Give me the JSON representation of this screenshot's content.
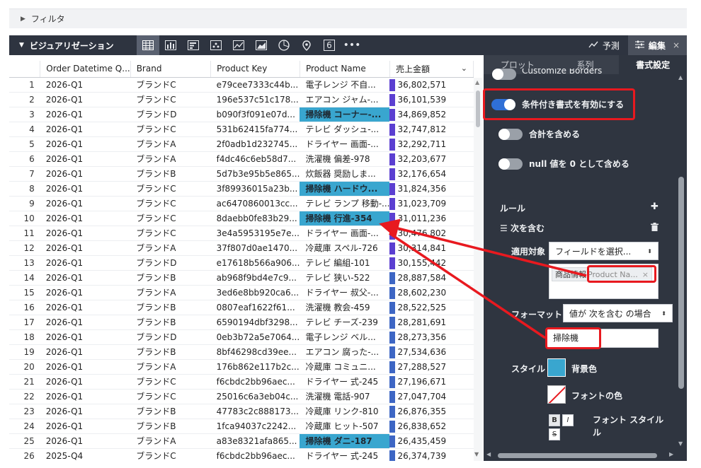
{
  "filter": {
    "label": "フィルタ"
  },
  "viz": {
    "title": "ビジュアリゼーション",
    "icons": [
      "table-icon",
      "bar-chart-icon",
      "horizontal-bar-icon",
      "scatter-icon",
      "line-chart-icon",
      "area-chart-icon",
      "pie-chart-icon",
      "map-pin-icon",
      "single-value-icon",
      "more-icon"
    ],
    "single_value_label": "6",
    "more_label": "•••",
    "forecast_label": "予測",
    "edit_label": "編集",
    "close_label": "×"
  },
  "table": {
    "columns": [
      "Order Datetime Q...",
      "Brand",
      "Product Key",
      "Product Name",
      "売上金額"
    ],
    "bar_colors": {
      "high": "#5b3fd1",
      "low": "#3d66c4"
    },
    "rows": [
      {
        "n": "1",
        "q": "2026-Q1",
        "brand": "ブランドC",
        "key": "e79cee7333c44b...",
        "name": "電子レンジ 不自...",
        "sales": "36,802,571",
        "hl": false,
        "bar": "high"
      },
      {
        "n": "2",
        "q": "2026-Q1",
        "brand": "ブランドC",
        "key": "196e537c51c178...",
        "name": "エアコン ジャム-...",
        "sales": "36,101,539",
        "hl": false,
        "bar": "high"
      },
      {
        "n": "3",
        "q": "2026-Q1",
        "brand": "ブランドD",
        "key": "b090f3f091e07d...",
        "name": "掃除機 コーナー-...",
        "sales": "34,869,852",
        "hl": true,
        "bar": "high"
      },
      {
        "n": "4",
        "q": "2026-Q1",
        "brand": "ブランドC",
        "key": "531b62415fa774...",
        "name": "テレビ ダッシュ-...",
        "sales": "32,747,812",
        "hl": false,
        "bar": "high"
      },
      {
        "n": "5",
        "q": "2026-Q1",
        "brand": "ブランドA",
        "key": "2f0adb1d232745...",
        "name": "ドライヤー 画面-...",
        "sales": "32,292,711",
        "hl": false,
        "bar": "high"
      },
      {
        "n": "6",
        "q": "2026-Q1",
        "brand": "ブランドA",
        "key": "f4dc46c6eb58d7...",
        "name": "洗濯機 偏差-978",
        "sales": "32,203,677",
        "hl": false,
        "bar": "high"
      },
      {
        "n": "7",
        "q": "2026-Q1",
        "brand": "ブランドB",
        "key": "5d7b3e95b5e865...",
        "name": "炊飯器 奨励しま...",
        "sales": "32,176,654",
        "hl": false,
        "bar": "high"
      },
      {
        "n": "8",
        "q": "2026-Q1",
        "brand": "ブランドC",
        "key": "3f89936015a23b...",
        "name": "掃除機 ハードウ...",
        "sales": "31,824,356",
        "hl": true,
        "bar": "high"
      },
      {
        "n": "9",
        "q": "2026-Q1",
        "brand": "ブランドC",
        "key": "ac6470860013cc...",
        "name": "テレビ ランプ 移動-...",
        "sales": "31,023,709",
        "hl": false,
        "bar": "high"
      },
      {
        "n": "10",
        "q": "2026-Q1",
        "brand": "ブランドC",
        "key": "8daebb0fe83b29...",
        "name": "掃除機 行進-354",
        "sales": "31,011,236",
        "hl": true,
        "bar": "high"
      },
      {
        "n": "11",
        "q": "2026-Q1",
        "brand": "ブランドC",
        "key": "3e4a5953195e7e...",
        "name": "ドライヤー 画面-...",
        "sales": "30,476,802",
        "hl": false,
        "bar": "high"
      },
      {
        "n": "12",
        "q": "2026-Q1",
        "brand": "ブランドA",
        "key": "37f807d0ae1470...",
        "name": "冷蔵庫 スペル-726",
        "sales": "30,314,841",
        "hl": false,
        "bar": "high"
      },
      {
        "n": "13",
        "q": "2026-Q1",
        "brand": "ブランドD",
        "key": "e17618b566a906...",
        "name": "テレビ 編組-101",
        "sales": "30,155,442",
        "hl": false,
        "bar": "high"
      },
      {
        "n": "14",
        "q": "2026-Q1",
        "brand": "ブランドB",
        "key": "ab968f9bd4e7c9...",
        "name": "テレビ 狭い-522",
        "sales": "28,887,584",
        "hl": false,
        "bar": "low"
      },
      {
        "n": "15",
        "q": "2026-Q1",
        "brand": "ブランドA",
        "key": "3ed6e8bb920ca6...",
        "name": "ドライヤー 叔父-...",
        "sales": "28,602,230",
        "hl": false,
        "bar": "low"
      },
      {
        "n": "16",
        "q": "2026-Q1",
        "brand": "ブランドB",
        "key": "0807eaf1622f61...",
        "name": "洗濯機 教会-459",
        "sales": "28,522,525",
        "hl": false,
        "bar": "low"
      },
      {
        "n": "17",
        "q": "2026-Q1",
        "brand": "ブランドB",
        "key": "6590194dbf3298...",
        "name": "テレビ チーズ-239",
        "sales": "28,281,691",
        "hl": false,
        "bar": "low"
      },
      {
        "n": "18",
        "q": "2026-Q1",
        "brand": "ブランドD",
        "key": "0eb3b72a5e7064...",
        "name": "電子レンジ ベル...",
        "sales": "28,273,356",
        "hl": false,
        "bar": "low"
      },
      {
        "n": "19",
        "q": "2026-Q1",
        "brand": "ブランドB",
        "key": "8bf46298cd39ee...",
        "name": "エアコン 腐った-...",
        "sales": "27,534,636",
        "hl": false,
        "bar": "low"
      },
      {
        "n": "20",
        "q": "2026-Q1",
        "brand": "ブランドA",
        "key": "176b862e117b2c...",
        "name": "冷蔵庫 コミュニ...",
        "sales": "27,288,527",
        "hl": false,
        "bar": "low"
      },
      {
        "n": "21",
        "q": "2026-Q1",
        "brand": "ブランドC",
        "key": "f6cbdc2bb96aec...",
        "name": "ドライヤー 式-245",
        "sales": "27,196,671",
        "hl": false,
        "bar": "low"
      },
      {
        "n": "22",
        "q": "2026-Q1",
        "brand": "ブランドC",
        "key": "25016c6a3eb04c...",
        "name": "洗濯機 電話-907",
        "sales": "27,047,704",
        "hl": false,
        "bar": "low"
      },
      {
        "n": "23",
        "q": "2026-Q1",
        "brand": "ブランドB",
        "key": "47783c2c888173...",
        "name": "冷蔵庫 リンク-810",
        "sales": "26,876,355",
        "hl": false,
        "bar": "low"
      },
      {
        "n": "24",
        "q": "2026-Q1",
        "brand": "ブランドB",
        "key": "1fca94037c2242...",
        "name": "冷蔵庫 ヒット-507",
        "sales": "26,838,652",
        "hl": false,
        "bar": "low"
      },
      {
        "n": "25",
        "q": "2026-Q1",
        "brand": "ブランドA",
        "key": "a83e8321afa865...",
        "name": "掃除機 ダニ-187",
        "sales": "26,435,459",
        "hl": true,
        "bar": "low"
      },
      {
        "n": "26",
        "q": "2025-Q4",
        "brand": "ブランドC",
        "key": "f6cbdc2bb96aec...",
        "name": "ドライヤー 式-245",
        "sales": "26,374,739",
        "hl": false,
        "bar": "low"
      }
    ]
  },
  "panel": {
    "tabs": [
      "プロット",
      "系列",
      "書式設定"
    ],
    "customize_borders": "Customize Borders",
    "cond_format": "条件付き書式を有効にする",
    "include_total": "合計を含める",
    "null_as_zero": "null 値を 0 として含める",
    "rules_label": "ルール",
    "add_icon": "✚",
    "rule_title": "次を含む",
    "apply_to_label": "適用対象",
    "apply_to_value": "フィールドを選択...",
    "chip_group": "商品情報",
    "chip_field": "Product Na...",
    "chip_remove": "×",
    "format_label": "フォーマット",
    "format_value": "値が 次を含む の場合",
    "value_input": "掃除機",
    "style_label": "スタイル",
    "bg_color_label": "背景色",
    "font_color_label": "フォントの色",
    "font_style_label": "フォント スタイル",
    "font_style_label_line2": "ル",
    "font_btn_bold": "B",
    "font_btn_italic": "I",
    "font_btn_strike": "S"
  },
  "colors": {
    "highlight": "#39a6cf",
    "annotation_red": "#e8191f",
    "toggle_on": "#2f6fd6",
    "panel_bg": "#2f3540"
  }
}
